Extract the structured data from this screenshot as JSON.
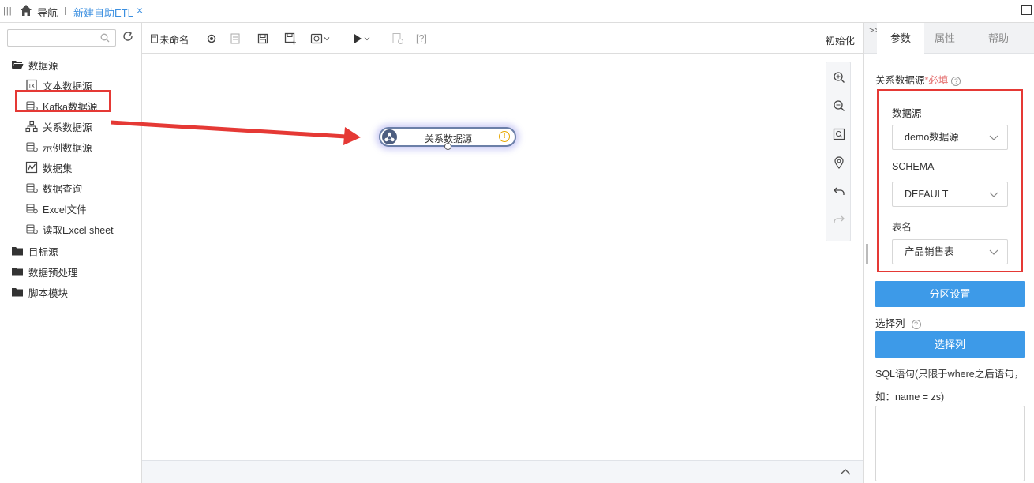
{
  "topbar": {
    "nav_label": "导航",
    "active_tab": "新建自助ETL",
    "close_glyph": "×"
  },
  "left": {
    "search_placeholder": "",
    "tree": [
      {
        "label": "数据源",
        "icon": "folder-open-icon"
      },
      {
        "label": "文本数据源",
        "icon": "text-source-icon"
      },
      {
        "label": "Kafka数据源",
        "icon": "db-source-icon"
      },
      {
        "label": "关系数据源",
        "icon": "relational-source-icon"
      },
      {
        "label": "示例数据源",
        "icon": "db-source-icon"
      },
      {
        "label": "数据集",
        "icon": "dataset-icon"
      },
      {
        "label": "数据查询",
        "icon": "db-source-icon"
      },
      {
        "label": "Excel文件",
        "icon": "db-source-icon"
      },
      {
        "label": "读取Excel sheet",
        "icon": "db-source-icon"
      },
      {
        "label": "目标源",
        "icon": "folder-icon"
      },
      {
        "label": "数据预处理",
        "icon": "folder-icon"
      },
      {
        "label": "脚本模块",
        "icon": "folder-icon"
      }
    ]
  },
  "toolbar": {
    "name_label": "未命名",
    "help_label": "[?]",
    "reset_label": "初始化"
  },
  "canvas": {
    "node_label": "关系数据源",
    "warn_glyph": "!"
  },
  "right": {
    "tabs": [
      "参数",
      "属性",
      "帮助"
    ],
    "active_tab": 0,
    "section_label": "关系数据源",
    "required_label": "*必填",
    "datasource_label": "数据源",
    "datasource_value": "demo数据源",
    "schema_label": "SCHEMA",
    "schema_value": "DEFAULT",
    "table_label": "表名",
    "table_value": "产品销售表",
    "partition_button": "分区设置",
    "select_cols_label": "选择列",
    "select_cols_button": "选择列",
    "sql_label_line1": "SQL语句(只限于where之后语句，",
    "sql_label_line2": "如：name = zs)",
    "sql_value": ""
  },
  "colors": {
    "accent": "#3d9ae8",
    "highlight": "#e53935",
    "tab_active_text": "#3b8fe0"
  }
}
